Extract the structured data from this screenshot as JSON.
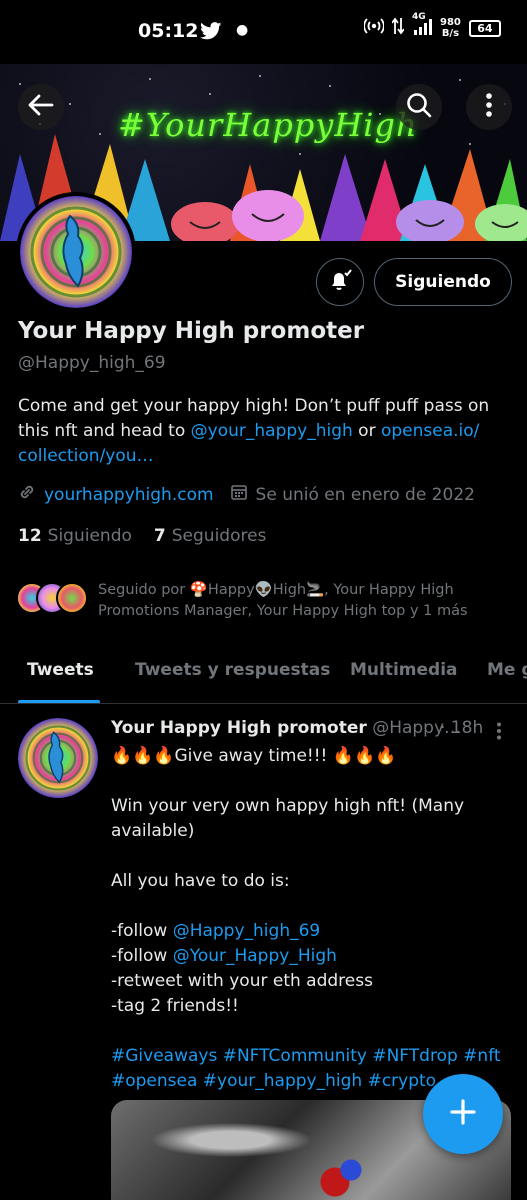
{
  "status_bar": {
    "time": "05:12",
    "speed_value": "980",
    "speed_unit": "B/s",
    "network": "4G",
    "battery": "64"
  },
  "banner": {
    "title": "#YourHappyHigh",
    "title_color": "#7dff3a"
  },
  "header_actions": {
    "back_icon": "arrow-left-icon",
    "search_icon": "search-icon",
    "more_icon": "more-vertical-icon"
  },
  "profile_actions": {
    "notifications_icon": "bell-check-icon",
    "follow_label": "Siguiendo"
  },
  "profile": {
    "display_name": "Your Happy High promoter",
    "handle": "@Happy_high_69",
    "bio_text_1": "Come and get your happy high! Don’t puff puff pass on this nft and head to ",
    "bio_link_1": "@your_happy_high",
    "bio_text_2": " or ",
    "bio_link_2": "opensea.io/ collection/you…",
    "website": "yourhappyhigh.com",
    "joined": "Se unió en enero de 2022",
    "following_count": "12",
    "following_label": "Siguiendo",
    "followers_count": "7",
    "followers_label": "Seguidores",
    "followed_by": "Seguido por 🍄Happy👽High🚬, Your Happy High Promotions Manager, Your Happy High top y 1 más"
  },
  "tabs": [
    "Tweets",
    "Tweets y respuestas",
    "Multimedia",
    "Me gusta"
  ],
  "tweet": {
    "name": "Your Happy High promoter",
    "handle": "@Happy…",
    "time": "· 18h",
    "line1": "🔥🔥🔥Give away time!!! 🔥🔥🔥",
    "line2": "Win your very own happy high nft! (Many available)",
    "line3": "All you have to do is:",
    "line4_prefix": "-follow ",
    "line4_link": "@Happy_high_69",
    "line5_prefix": "-follow ",
    "line5_link": "@Your_Happy_High",
    "line6": "-retweet with your eth address",
    "line7": "-tag 2 friends!!",
    "hashtags": "#Giveaways #NFTCommunity #NFTdrop #nft #opensea #your_happy_high #crypto"
  },
  "colors": {
    "accent": "#1d9bf0",
    "muted": "#71767b",
    "text": "#e7e9ea",
    "background": "#000000"
  }
}
